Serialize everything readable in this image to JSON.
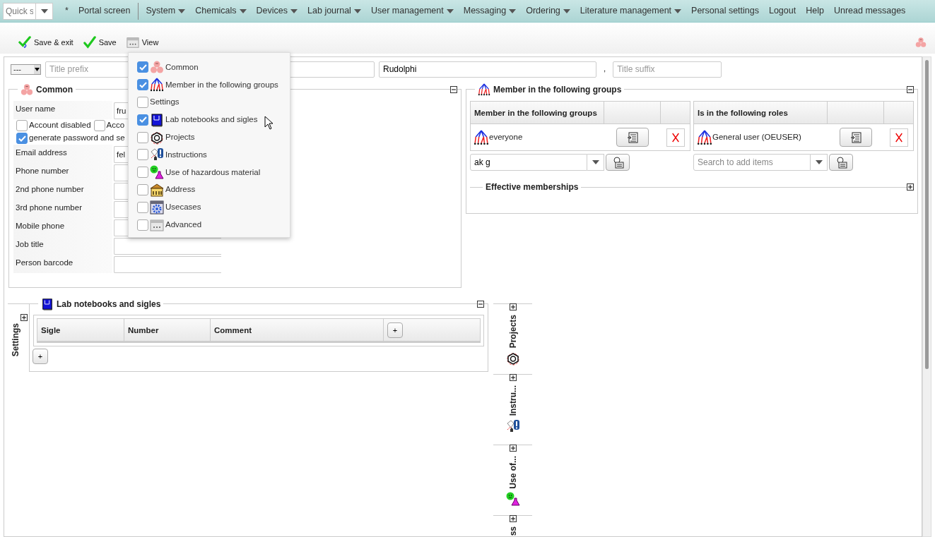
{
  "navbar": {
    "quick_search": {
      "placeholder": "Quick s"
    },
    "items": [
      {
        "label": "*",
        "dropdown": false,
        "separator_after": false
      },
      {
        "label": "Portal screen",
        "dropdown": false,
        "separator_after": true
      },
      {
        "label": "System",
        "dropdown": true,
        "separator_after": false
      },
      {
        "label": "Chemicals",
        "dropdown": true,
        "separator_after": false
      },
      {
        "label": "Devices",
        "dropdown": true,
        "separator_after": false
      },
      {
        "label": "Lab journal",
        "dropdown": true,
        "separator_after": false
      },
      {
        "label": "User management",
        "dropdown": true,
        "separator_after": false
      },
      {
        "label": "Messaging",
        "dropdown": true,
        "separator_after": false
      },
      {
        "label": "Ordering",
        "dropdown": true,
        "separator_after": false
      },
      {
        "label": "Literature management",
        "dropdown": true,
        "separator_after": false
      },
      {
        "label": "Personal settings",
        "dropdown": false,
        "separator_after": false
      },
      {
        "label": "Logout",
        "dropdown": false,
        "separator_after": false
      },
      {
        "label": "Help",
        "dropdown": false,
        "separator_after": false
      },
      {
        "label": "Unread messages",
        "dropdown": false,
        "separator_after": false
      }
    ]
  },
  "toolbar": {
    "buttons": [
      {
        "label": "Save & exit",
        "kind": "save-exit"
      },
      {
        "label": "Save",
        "kind": "save"
      },
      {
        "label": "View",
        "kind": "view"
      }
    ]
  },
  "view_menu": {
    "items": [
      {
        "label": "Common",
        "checked": true,
        "kind": "common"
      },
      {
        "label": "Member in the following groups",
        "checked": true,
        "kind": "groups"
      },
      {
        "label": "Settings",
        "checked": false,
        "kind": "none"
      },
      {
        "label": "Lab notebooks and sigles",
        "checked": true,
        "kind": "notebook"
      },
      {
        "label": "Projects",
        "checked": false,
        "kind": "projects"
      },
      {
        "label": "Instructions",
        "checked": false,
        "kind": "instructions"
      },
      {
        "label": "Use of hazardous material",
        "checked": false,
        "kind": "hazard"
      },
      {
        "label": "Address",
        "checked": false,
        "kind": "address"
      },
      {
        "label": "Usecases",
        "checked": false,
        "kind": "usecases"
      },
      {
        "label": "Advanced",
        "checked": false,
        "kind": "advanced"
      }
    ]
  },
  "name_row": {
    "salutation": "---",
    "title_prefix": {
      "placeholder": "Title prefix"
    },
    "last_name": "Rudolphi",
    "separator": ",",
    "title_suffix": {
      "placeholder": "Title suffix"
    }
  },
  "common": {
    "title": "Common",
    "expanded": true,
    "rows": [
      {
        "kind": "field",
        "label": "User name",
        "value": "fru"
      },
      {
        "kind": "checkboxes",
        "items": [
          {
            "label": "Account disabled",
            "checked": false
          },
          {
            "label": "Acco",
            "checked": false
          }
        ]
      },
      {
        "kind": "checkboxes",
        "items": [
          {
            "label": "generate password and se",
            "checked": true
          }
        ]
      },
      {
        "kind": "field",
        "label": "Email address",
        "value": "fel"
      },
      {
        "kind": "field",
        "label": "Phone number"
      },
      {
        "kind": "field",
        "label": "2nd phone number"
      },
      {
        "kind": "field",
        "label": "3rd phone number"
      },
      {
        "kind": "field",
        "label": "Mobile phone"
      },
      {
        "kind": "field",
        "label": "Job title"
      },
      {
        "kind": "field",
        "label": "Person barcode"
      }
    ]
  },
  "groups": {
    "title": "Member in the following groups",
    "expanded": true,
    "tables": [
      {
        "column": "Member in the following groups",
        "rows": [
          {
            "label": "everyone"
          }
        ],
        "search": {
          "value": "ak g"
        }
      },
      {
        "column": "Is in the following roles",
        "rows": [
          {
            "label": "General user (OEUSER)"
          }
        ],
        "search": {
          "placeholder": "Search to add items"
        }
      }
    ],
    "effective": {
      "title": "Effective memberships",
      "expanded": false
    }
  },
  "settings_tab": {
    "label": "Settings",
    "expanded": false
  },
  "lab_notebooks": {
    "title": "Lab notebooks and sigles",
    "expanded": true,
    "columns": [
      "Sigle",
      "Number",
      "Comment"
    ],
    "add_column": "+",
    "add_row": "+"
  },
  "side_tabs": [
    {
      "label": "Projects",
      "kind": "projects",
      "expanded": false
    },
    {
      "label": "Instru...",
      "kind": "instructions",
      "expanded": false
    },
    {
      "label": "Use of...",
      "kind": "hazard",
      "expanded": false
    },
    {
      "label": "ss",
      "kind": "none",
      "expanded": false
    }
  ]
}
